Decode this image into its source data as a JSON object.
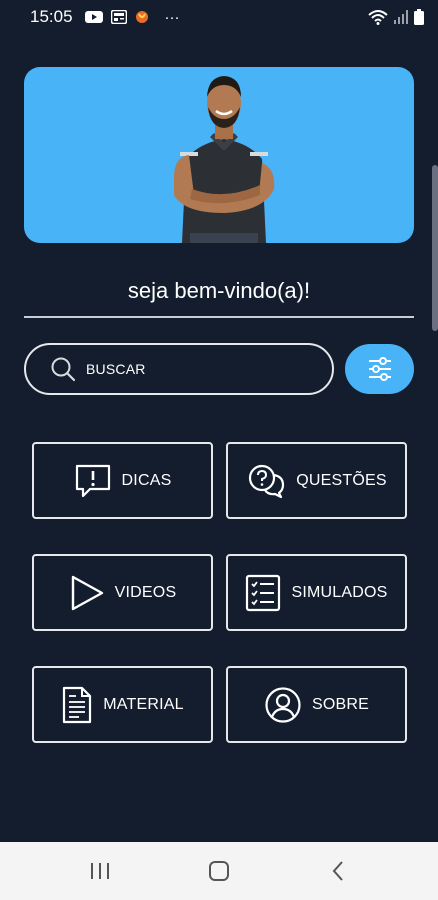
{
  "status_bar": {
    "time": "15:05",
    "icons": [
      "youtube-icon",
      "news-icon",
      "app-icon",
      "more-icon",
      "wifi-icon",
      "signal-icon",
      "battery-icon"
    ],
    "more": "···"
  },
  "hero": {
    "image": "instructor-photo",
    "background_color": "#49b3f7"
  },
  "welcome": {
    "text": "seja bem-vindo(a)!"
  },
  "search": {
    "placeholder": "BUSCAR",
    "icon": "search-icon"
  },
  "filter": {
    "icon": "sliders-icon"
  },
  "menu": {
    "items": [
      {
        "label": "DICAS",
        "icon": "alert-message-icon"
      },
      {
        "label": "QUESTÕES",
        "icon": "question-chat-icon"
      },
      {
        "label": "VIDEOS",
        "icon": "play-icon"
      },
      {
        "label": "SIMULADOS",
        "icon": "checklist-icon"
      },
      {
        "label": "MATERIAL",
        "icon": "document-icon"
      },
      {
        "label": "SOBRE",
        "icon": "user-circle-icon"
      }
    ]
  },
  "nav": {
    "buttons": [
      "recent-apps-icon",
      "home-icon",
      "back-icon"
    ]
  },
  "colors": {
    "background": "#141d2e",
    "accent": "#49b3f7",
    "border": "#e6e8ec",
    "nav_bar": "#f4f4f4"
  }
}
